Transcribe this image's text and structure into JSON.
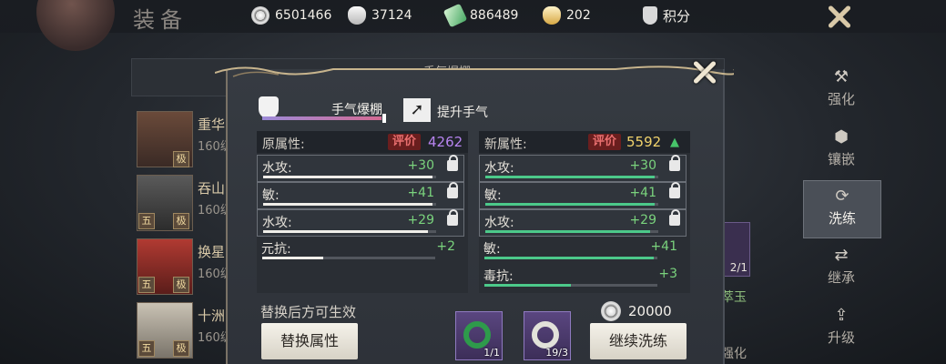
{
  "page": {
    "title": "装备"
  },
  "resources": [
    {
      "icon": "silver-coin-icon",
      "value": "6501466"
    },
    {
      "icon": "silver-ingot-icon",
      "value": "37124"
    },
    {
      "icon": "jade-icon",
      "value": "886489"
    },
    {
      "icon": "gold-ingot-icon",
      "value": "202"
    },
    {
      "icon": "points-shield-icon",
      "value": "积分"
    }
  ],
  "background": {
    "header_label": "手气爆棚",
    "items": [
      {
        "name": "重华",
        "level": "160级",
        "badge": "极"
      },
      {
        "name": "吞山",
        "level": "160级",
        "badge": "极",
        "grade": "五"
      },
      {
        "name": "换星",
        "level": "160级",
        "badge": "极",
        "grade": "五"
      },
      {
        "name": "十洲",
        "level": "160级",
        "badge": "极",
        "grade": "五"
      }
    ],
    "right_item_count": "2/1",
    "right_item_name": "萃玉",
    "right_item_label": "强化"
  },
  "sidebar": {
    "items": [
      {
        "label": "强化",
        "icon": "hammer-icon"
      },
      {
        "label": "镶嵌",
        "icon": "gem-icon"
      },
      {
        "label": "洗练",
        "icon": "refine-icon",
        "active": true
      },
      {
        "label": "继承",
        "icon": "inherit-icon"
      },
      {
        "label": "升级",
        "icon": "upgrade-icon"
      }
    ]
  },
  "dialog": {
    "rarity_label": "手气爆棚",
    "rarity_fill": 0.97,
    "upgrade_label": "提升手气",
    "old": {
      "title": "原属性:",
      "seal": "评价",
      "score": "4262",
      "attrs": [
        {
          "name": "水攻:",
          "value": "+30",
          "fill": 0.98,
          "locked": true
        },
        {
          "name": "敏:",
          "value": "+41",
          "fill": 0.98,
          "locked": true
        },
        {
          "name": "水攻:",
          "value": "+29",
          "fill": 0.95,
          "locked": true
        },
        {
          "name": "元抗:",
          "value": "+2",
          "fill": 0.35,
          "locked": false
        }
      ]
    },
    "new": {
      "title": "新属性:",
      "seal": "评价",
      "score": "5592",
      "score_arrow": "▲",
      "attrs": [
        {
          "name": "水攻:",
          "value": "+30",
          "fill": 0.98,
          "locked": true
        },
        {
          "name": "敏:",
          "value": "+41",
          "fill": 0.98,
          "locked": true
        },
        {
          "name": "水攻:",
          "value": "+29",
          "fill": 0.95,
          "locked": true
        },
        {
          "name": "敏:",
          "value": "+41",
          "fill": 0.98,
          "locked": false
        },
        {
          "name": "毒抗:",
          "value": "+3",
          "fill": 0.5,
          "locked": false
        }
      ]
    },
    "hint": "替换后方可生效",
    "replace_button": "替换属性",
    "materials": [
      {
        "icon": "green-jade-ring-icon",
        "count": "1/1"
      },
      {
        "icon": "white-jade-ring-icon",
        "count": "19/3"
      }
    ],
    "cost": "20000",
    "continue_button": "继续洗练"
  }
}
